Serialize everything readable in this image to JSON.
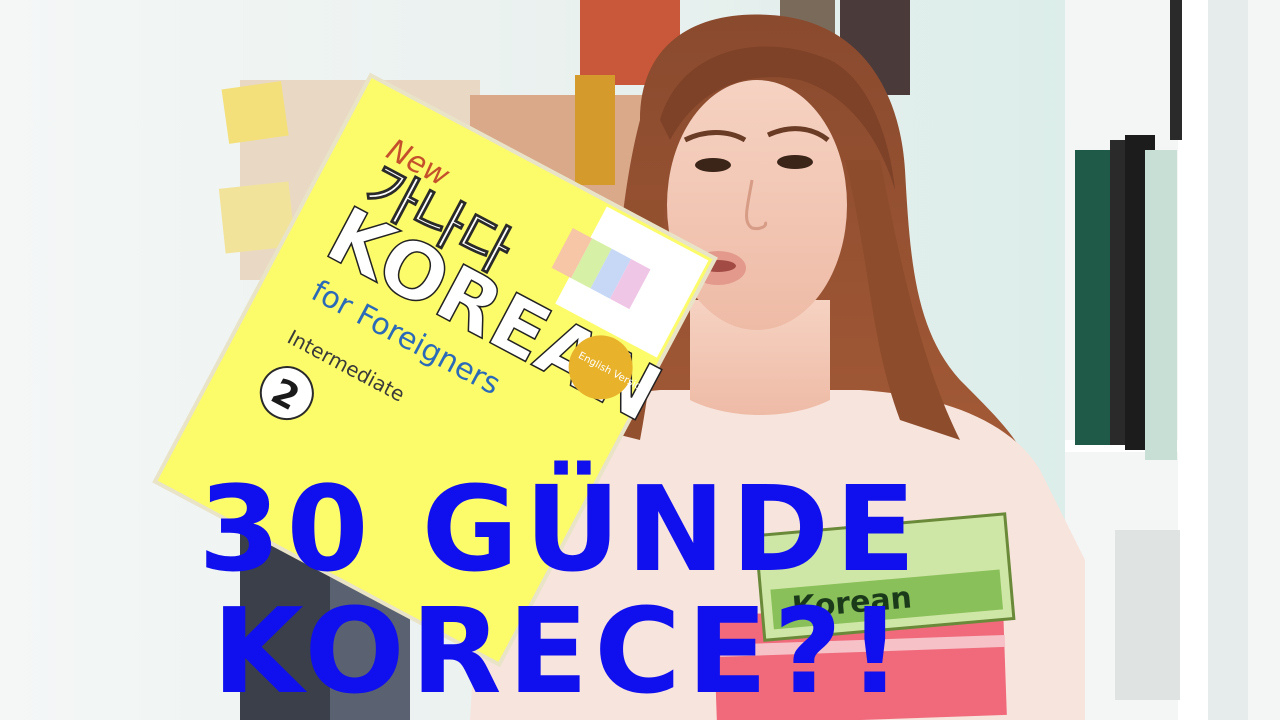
{
  "overlay": {
    "line1": "30 GÜNDE",
    "line2": "KORECE?!",
    "color": "#1010ee"
  },
  "book_cover": {
    "new": "New",
    "hangul": "가나다",
    "title": "KOREAN",
    "subtitle": "for Foreigners",
    "level": "Intermediate",
    "volume": "2",
    "badge": "English Version"
  },
  "green_book": {
    "title": "Korean"
  }
}
